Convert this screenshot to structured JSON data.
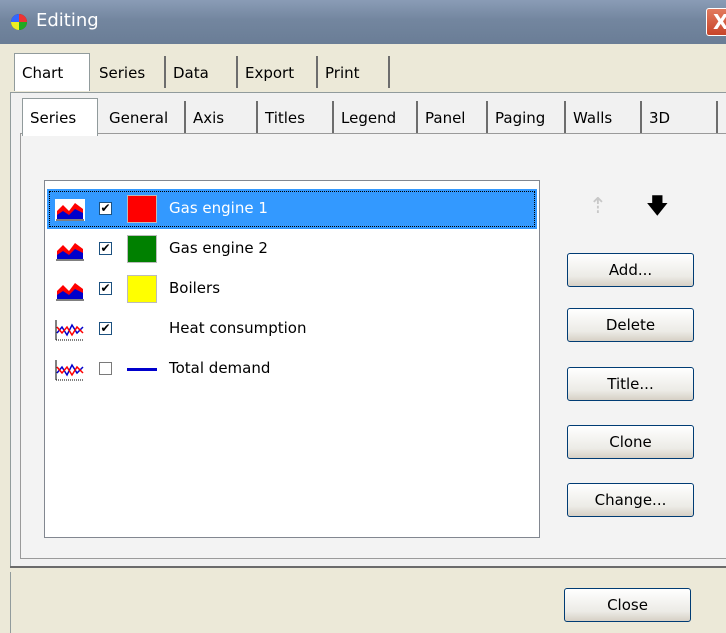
{
  "window": {
    "title": "Editing",
    "close_glyph": "X"
  },
  "outer_tabs": [
    "Chart",
    "Series",
    "Data",
    "Export",
    "Print"
  ],
  "inner_tabs": [
    "Series",
    "General",
    "Axis",
    "Titles",
    "Legend",
    "Panel",
    "Paging",
    "Walls",
    "3D"
  ],
  "series": [
    {
      "label": "Gas engine 1",
      "checked": "✔",
      "icon": "area-chart-icon",
      "color": "#ff0000",
      "selected": true
    },
    {
      "label": "Gas engine 2",
      "checked": "✔",
      "icon": "area-chart-icon",
      "color": "#008000"
    },
    {
      "label": "Boilers",
      "checked": "✔",
      "icon": "area-chart-icon",
      "color": "#ffff00"
    },
    {
      "label": "Heat consumption",
      "checked": "✔",
      "icon": "line-chart-icon",
      "color": ""
    },
    {
      "label": "Total demand",
      "checked": "",
      "icon": "line-chart-icon",
      "color": "#0000cc"
    }
  ],
  "arrows": {
    "up": "⇡",
    "down": "🡇"
  },
  "buttons": {
    "add": "Add...",
    "delete": "Delete",
    "title": "Title...",
    "clone": "Clone",
    "change": "Change...",
    "close": "Close"
  }
}
